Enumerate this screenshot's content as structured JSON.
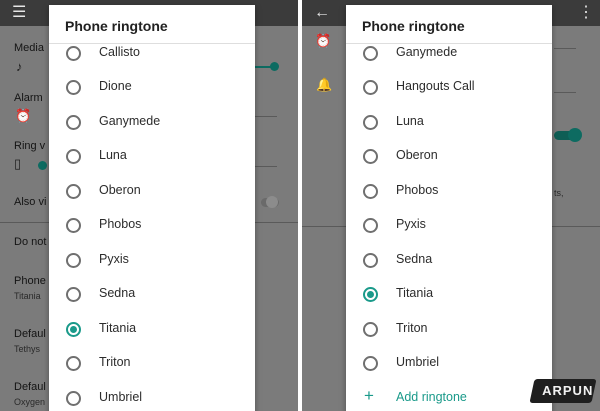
{
  "left": {
    "background": {
      "media": "Media",
      "alarm": "Alarm",
      "ring": "Ring v",
      "also_vibrate": "Also vi",
      "do_not": "Do not",
      "phone": "Phone",
      "phone_sub": "Titania",
      "default1": "Defaul",
      "default1_sub": "Tethys",
      "default2": "Defaul",
      "default2_sub": "Oxygen"
    },
    "dialog": {
      "title": "Phone ringtone",
      "options": [
        {
          "label": "Callisto",
          "checked": false
        },
        {
          "label": "Dione",
          "checked": false
        },
        {
          "label": "Ganymede",
          "checked": false
        },
        {
          "label": "Luna",
          "checked": false
        },
        {
          "label": "Oberon",
          "checked": false
        },
        {
          "label": "Phobos",
          "checked": false
        },
        {
          "label": "Pyxis",
          "checked": false
        },
        {
          "label": "Sedna",
          "checked": false
        },
        {
          "label": "Titania",
          "checked": true
        },
        {
          "label": "Triton",
          "checked": false
        },
        {
          "label": "Umbriel",
          "checked": false
        }
      ]
    }
  },
  "right": {
    "background": {
      "ts": "ts,"
    },
    "dialog": {
      "title": "Phone ringtone",
      "options": [
        {
          "label": "Ganymede",
          "checked": false
        },
        {
          "label": "Hangouts Call",
          "checked": false
        },
        {
          "label": "Luna",
          "checked": false
        },
        {
          "label": "Oberon",
          "checked": false
        },
        {
          "label": "Phobos",
          "checked": false
        },
        {
          "label": "Pyxis",
          "checked": false
        },
        {
          "label": "Sedna",
          "checked": false
        },
        {
          "label": "Titania",
          "checked": true
        },
        {
          "label": "Triton",
          "checked": false
        },
        {
          "label": "Umbriel",
          "checked": false
        }
      ],
      "add_label": "Add ringtone"
    }
  },
  "watermark": "ARPUN",
  "colors": {
    "accent": "#1a9a8a",
    "scrim": "#7b7b7b",
    "toolbar": "#3b3b3b"
  }
}
